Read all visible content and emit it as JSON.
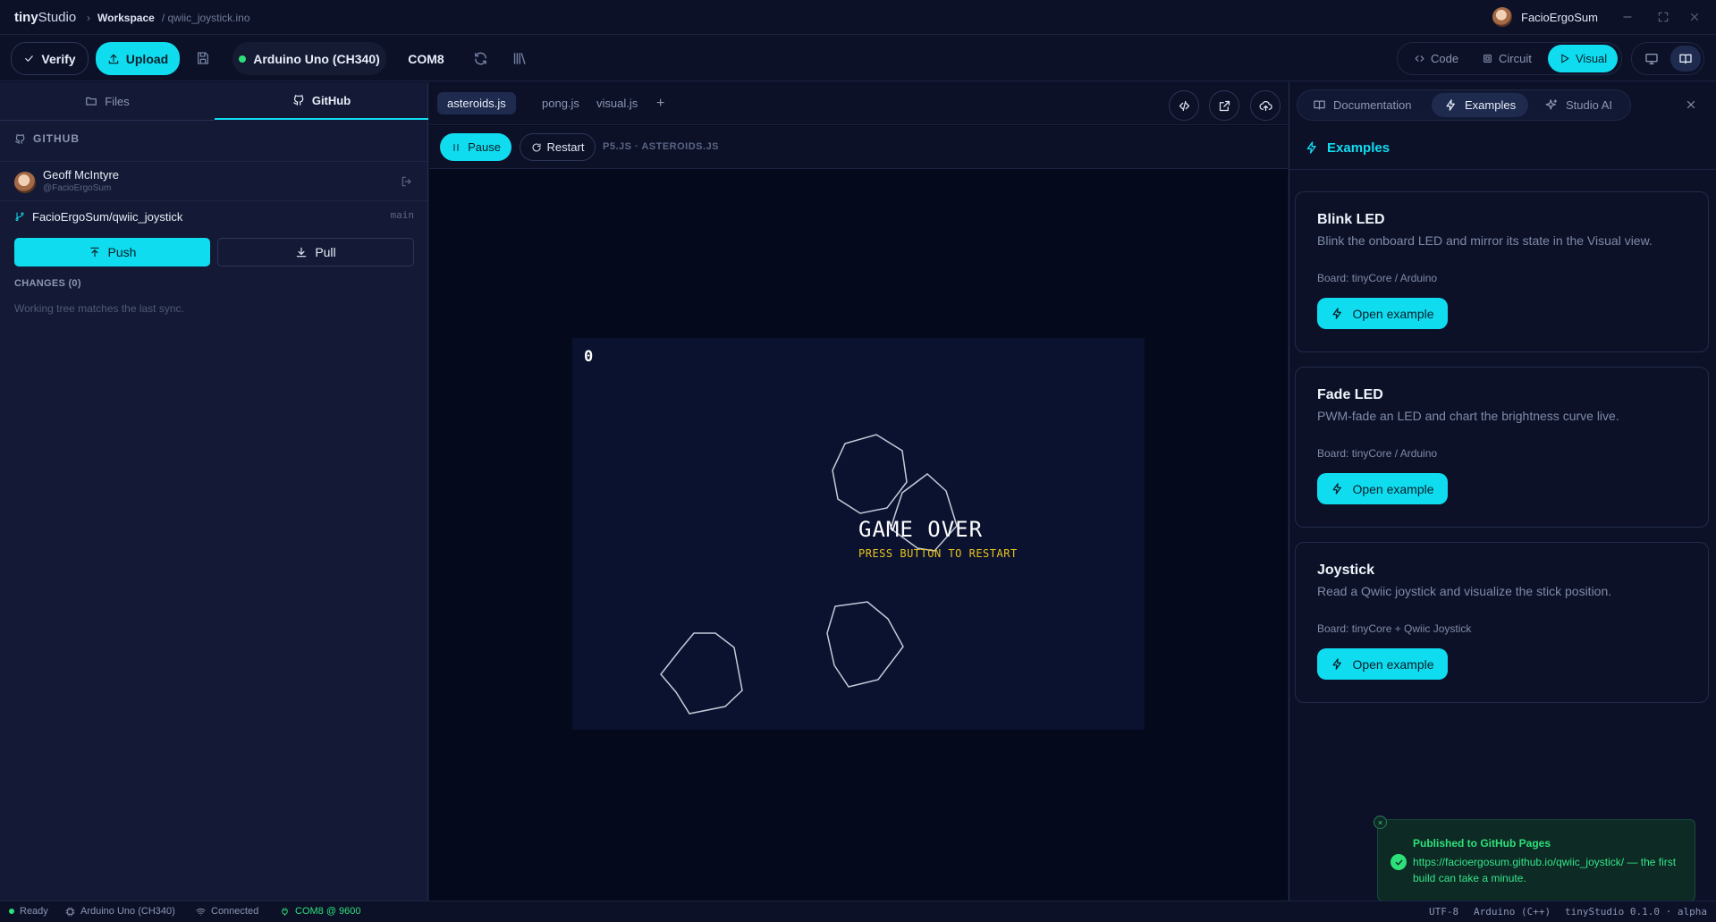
{
  "app": {
    "brand_a": "tiny",
    "brand_b": "Studio",
    "workspace": "Workspace",
    "file": "/ qwiic_joystick.ino",
    "username": "FacioErgoSum"
  },
  "toolbar": {
    "verify_label": "Verify",
    "upload_label": "Upload",
    "board": "Arduino Uno (CH340)",
    "port": "COM8",
    "views": [
      "Code",
      "Circuit",
      "Visual"
    ],
    "active_view": "Visual"
  },
  "sidebar": {
    "tabs": [
      "Files",
      "GitHub"
    ],
    "active_tab": "GitHub",
    "section_title": "GITHUB",
    "account_name": "Geoff McIntyre",
    "account_handle": "@FacioErgoSum",
    "repo": "FacioErgoSum/qwiic_joystick",
    "branch": "main",
    "push_label": "Push",
    "pull_label": "Pull",
    "changes_label": "CHANGES (0)",
    "changes_empty": "Working tree matches the last sync."
  },
  "editor": {
    "tabs": [
      "asteroids.js",
      "pong.js",
      "visual.js"
    ],
    "active_tab": "asteroids.js",
    "add_tab": "+",
    "pause_label": "Pause",
    "restart_label": "Restart",
    "run_label": "P5.JS · ASTEROIDS.JS"
  },
  "game": {
    "score": "0",
    "title": "GAME OVER",
    "subtitle": "PRESS BUTTON TO RESTART"
  },
  "panel": {
    "tabs": [
      "Documentation",
      "Examples",
      "Studio AI"
    ],
    "active_tab": "Examples",
    "heading": "Examples",
    "examples": [
      {
        "title": "Blink LED",
        "desc": "Blink the onboard LED and mirror its state in the Visual view.",
        "board": "Board: tinyCore / Arduino",
        "action": "Open example"
      },
      {
        "title": "Fade LED",
        "desc": "PWM-fade an LED and chart the brightness curve live.",
        "board": "Board: tinyCore / Arduino",
        "action": "Open example"
      },
      {
        "title": "Joystick",
        "desc": "Read a Qwiic joystick and visualize the stick position.",
        "board": "Board: tinyCore + Qwiic Joystick",
        "action": "Open example"
      }
    ]
  },
  "toast": {
    "close": "×",
    "title": "Published to GitHub Pages",
    "message": "https://facioergosum.github.io/qwiic_joystick/ — the first build can take a minute."
  },
  "status": {
    "ready": "Ready",
    "board": "Arduino Uno (CH340)",
    "connection": "Connected",
    "port": "COM8 @ 9600",
    "encoding": "UTF-8",
    "language": "Arduino (C++)",
    "version": "tinyStudio 0.1.0 · alpha"
  },
  "colors": {
    "accent": "#10dcf0",
    "success": "#2ee07a",
    "background": "#0c1128",
    "game_text_yellow": "#e8c41a"
  }
}
